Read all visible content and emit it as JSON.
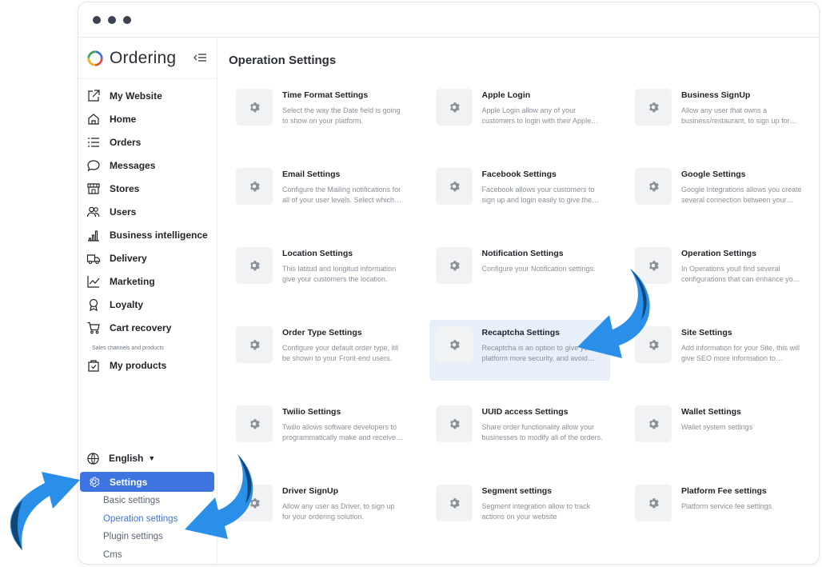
{
  "app": {
    "brand": "Ordering"
  },
  "sidebar": {
    "items": [
      {
        "label": "My Website",
        "icon": "external-link-icon"
      },
      {
        "label": "Home",
        "icon": "home-icon"
      },
      {
        "label": "Orders",
        "icon": "list-icon"
      },
      {
        "label": "Messages",
        "icon": "chat-icon"
      },
      {
        "label": "Stores",
        "icon": "shop-icon"
      },
      {
        "label": "Users",
        "icon": "users-icon"
      },
      {
        "label": "Business intelligence",
        "icon": "bar-chart-icon"
      },
      {
        "label": "Delivery",
        "icon": "truck-icon"
      },
      {
        "label": "Marketing",
        "icon": "line-chart-icon"
      },
      {
        "label": "Loyalty",
        "icon": "award-icon"
      },
      {
        "label": "Cart recovery",
        "icon": "cart-icon"
      }
    ],
    "section_caption": "Sales channels and products",
    "products": {
      "label": "My products",
      "icon": "box-icon"
    },
    "language": {
      "label": "English",
      "icon": "globe-icon"
    },
    "settings": {
      "label": "Settings",
      "icon": "gear-icon"
    },
    "sub_items": [
      {
        "label": "Basic settings"
      },
      {
        "label": "Operation settings",
        "active": true
      },
      {
        "label": "Plugin settings"
      },
      {
        "label": "Cms"
      }
    ]
  },
  "main": {
    "title": "Operation Settings",
    "cards": [
      {
        "title": "Time Format Settings",
        "desc": "Select the way the Date field is going to show on your platform."
      },
      {
        "title": "Apple Login",
        "desc": "Apple Login allow any of your customers to login with their Apple account."
      },
      {
        "title": "Business SignUp",
        "desc": "Allow any user that owns a business/restaurant, to sign up for your platform."
      },
      {
        "title": "Email Settings",
        "desc": "Configure the Mailing notifications for all of your user levels. Select which ones."
      },
      {
        "title": "Facebook Settings",
        "desc": "Facebook allows your customers to sign up and login easily to give them a better experience."
      },
      {
        "title": "Google Settings",
        "desc": "Google Integrations allows you create several connection between your platform and Google."
      },
      {
        "title": "Location Settings",
        "desc": "This latitud and longitud information give your customers the location."
      },
      {
        "title": "Notification Settings",
        "desc": "Configure your Notification settings."
      },
      {
        "title": "Operation Settings",
        "desc": "In Operations youll find several configurations that can enhance your business."
      },
      {
        "title": "Order Type Settings",
        "desc": "Configure your default order type, itll be shown to your Front-end users."
      },
      {
        "title": "Recaptcha Settings",
        "desc": "Recaptcha is an option to give your platform more security, and avoid bots.",
        "highlight": true
      },
      {
        "title": "Site Settings",
        "desc": "Add information for your Site, this will give SEO more information to crawlers."
      },
      {
        "title": "Twilio Settings",
        "desc": "Twilio allows software developers to programmatically make and receive calls."
      },
      {
        "title": "UUID access Settings",
        "desc": "Share order functionality allow your businesses to modify all of the orders."
      },
      {
        "title": "Wallet Settings",
        "desc": "Wallet system settings"
      },
      {
        "title": "Driver SignUp",
        "desc": "Allow any user as Driver, to sign up for your ordering solution."
      },
      {
        "title": "Segment settings",
        "desc": "Segment integration allow to track actions on your website"
      },
      {
        "title": "Platform Fee settings",
        "desc": "Platform service fee settings"
      }
    ]
  },
  "colors": {
    "accent": "#3d74e0",
    "arrow_light": "#2a8fe9",
    "arrow_dark": "#11467a"
  }
}
